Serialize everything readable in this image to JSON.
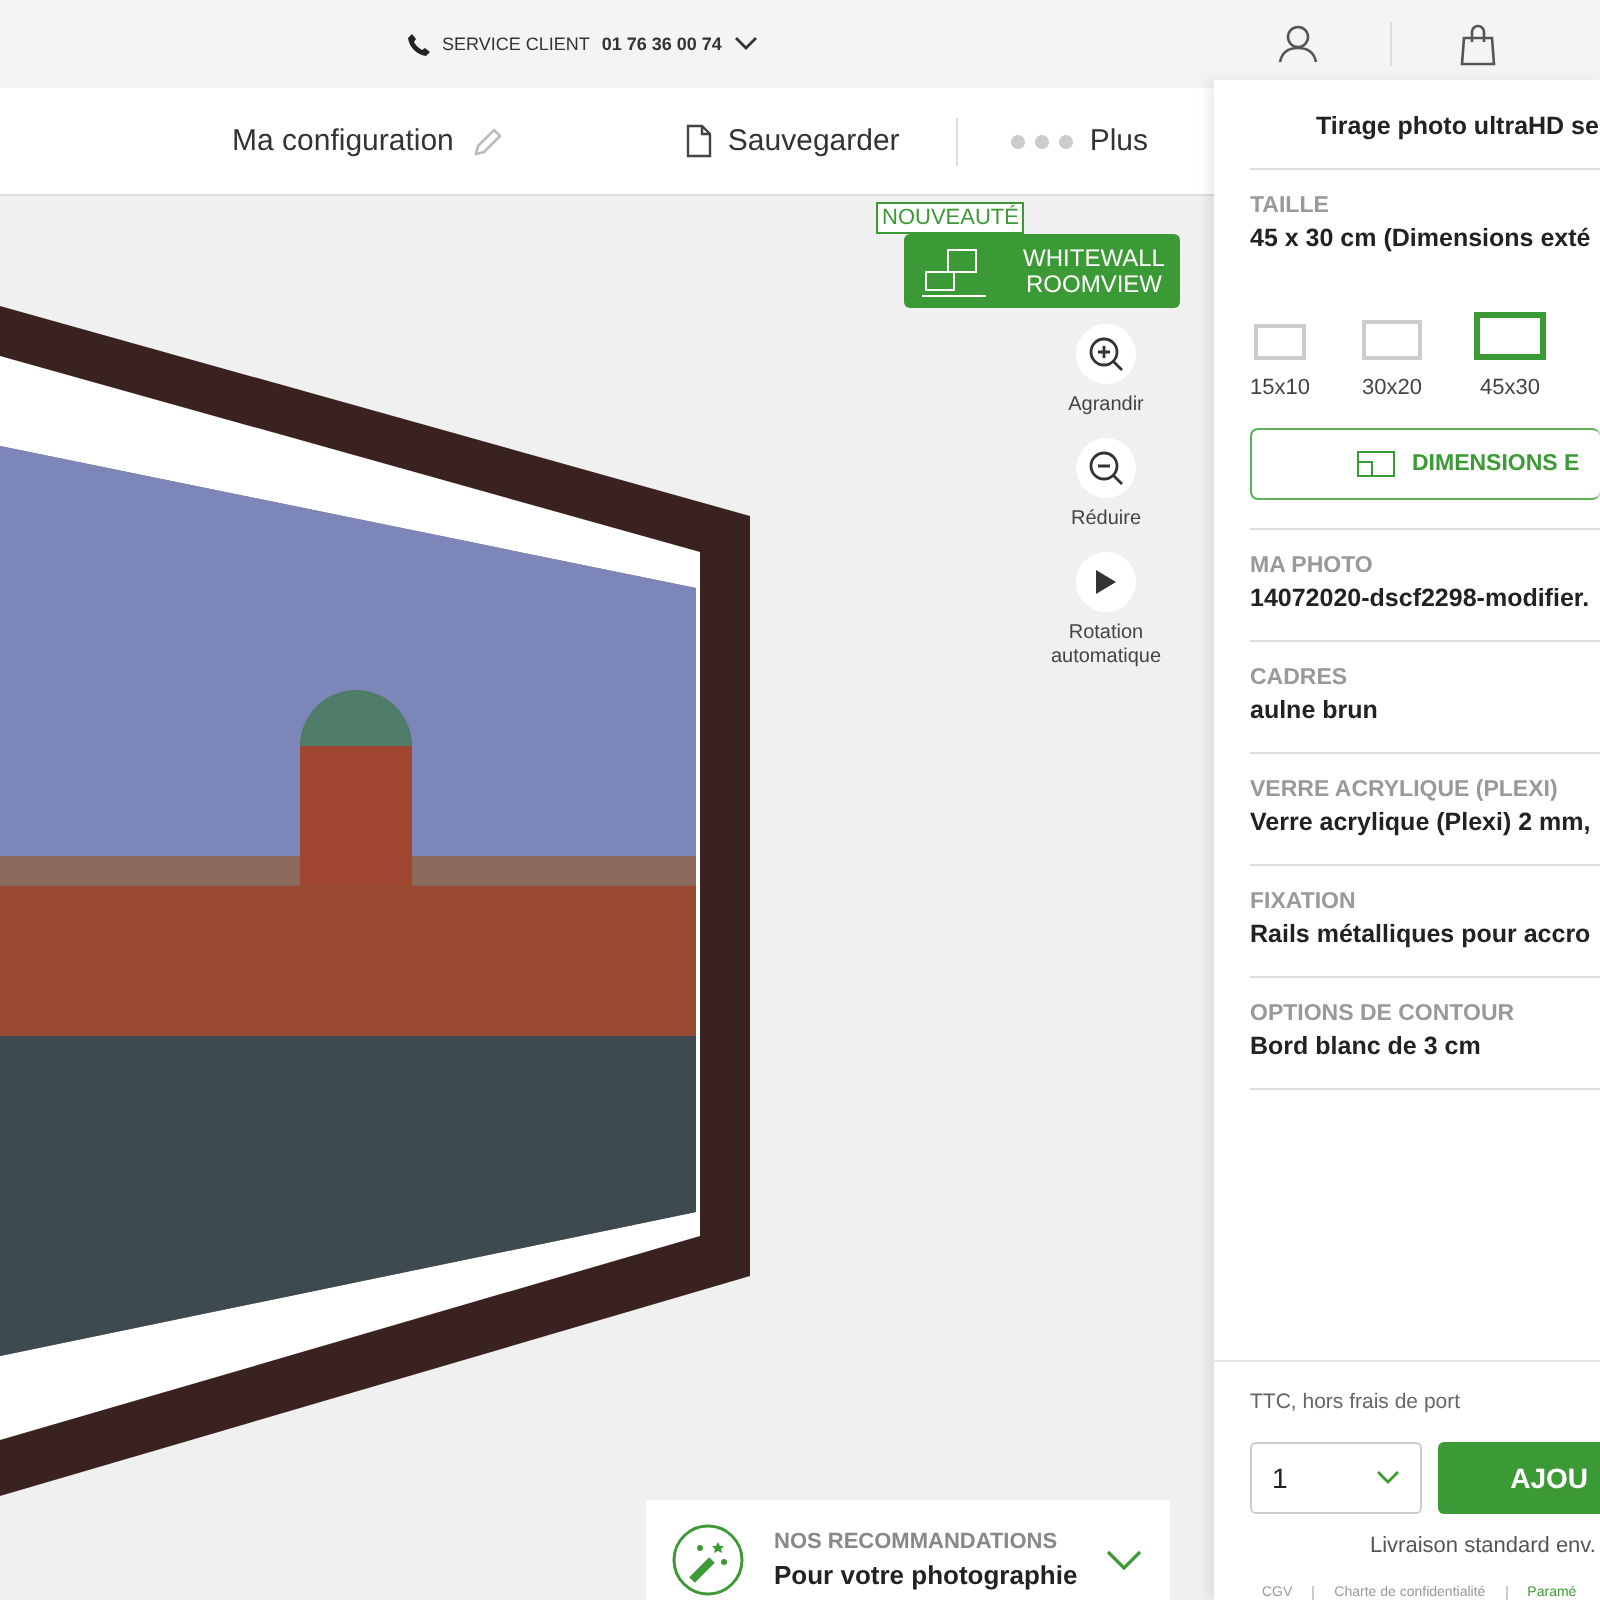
{
  "top_bar": {
    "service_label": "SERVICE CLIENT",
    "service_phone": "01 76 36 00 74"
  },
  "toolbar": {
    "config_title": "Ma configuration",
    "save": "Sauvegarder",
    "more": "Plus"
  },
  "roomview": {
    "badge": "NOUVEAUTÉ",
    "label_1": "WHITEWALL",
    "label_2": "ROOMVIEW"
  },
  "view_controls": [
    {
      "kind": "zoom_in",
      "label": "Agrandir"
    },
    {
      "kind": "zoom_out",
      "label": "Réduire"
    },
    {
      "kind": "play",
      "label": "Rotation automatique"
    }
  ],
  "recommendations": {
    "title": "NOS RECOMMANDATIONS",
    "subtitle": "Pour votre photographie"
  },
  "panel": {
    "product_title": "Tirage photo ultraHD se",
    "size": {
      "label": "TAILLE",
      "value": "45 x 30 cm (Dimensions exté",
      "options": [
        {
          "label": "15x10",
          "selected": false
        },
        {
          "label": "30x20",
          "selected": false
        },
        {
          "label": "45x30",
          "selected": true
        }
      ],
      "custom_button": "DIMENSIONS E"
    },
    "sections": [
      {
        "label": "MA PHOTO",
        "value": "14072020-dscf2298-modifier."
      },
      {
        "label": "CADRES",
        "value": "aulne brun"
      },
      {
        "label": "VERRE ACRYLIQUE (PLEXI)",
        "value": "Verre acrylique (Plexi) 2 mm,"
      },
      {
        "label": "FIXATION",
        "value": "Rails métalliques pour accro"
      },
      {
        "label": "OPTIONS DE CONTOUR",
        "value": "Bord blanc de 3 cm"
      }
    ],
    "price_note": "TTC, hors frais de port",
    "quantity": "1",
    "add_button": "AJOU",
    "delivery": "Livraison standard env.",
    "footer_links": [
      {
        "label": "CGV",
        "kind": "plain"
      },
      {
        "label": "Charte de confidentialité",
        "kind": "plain"
      },
      {
        "label": "Paramé",
        "kind": "accent"
      }
    ]
  }
}
